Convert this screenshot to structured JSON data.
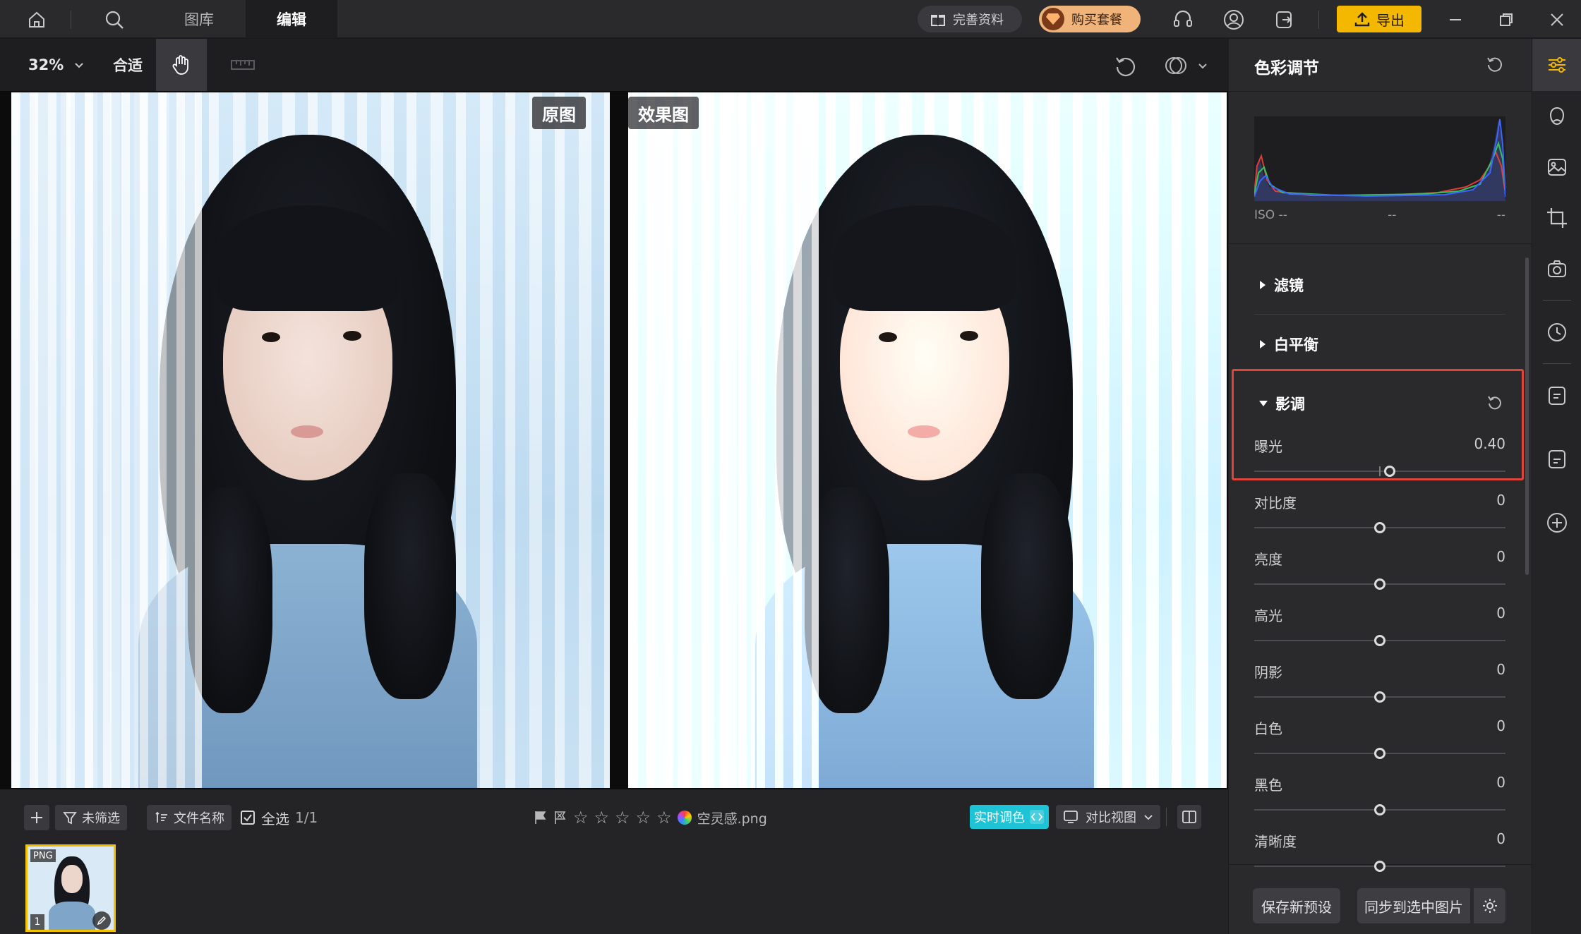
{
  "topbar": {
    "tabs": [
      {
        "label": "图库",
        "active": false
      },
      {
        "label": "编辑",
        "active": true
      }
    ],
    "complete_info_label": "完善资料",
    "buy_plan_label": "购买套餐",
    "export_label": "导出",
    "icons": [
      "home-icon",
      "search-icon",
      "gift-icon",
      "diamond-icon",
      "headset-icon",
      "user-icon",
      "logout-icon",
      "upload-icon",
      "minimize-icon",
      "restore-icon",
      "close-icon"
    ]
  },
  "toolbar": {
    "zoom_value": "32%",
    "fit_label": "合适",
    "icons": [
      "chevron-down-icon",
      "hand-icon",
      "ruler-icon",
      "undo-icon",
      "compare-circles-icon"
    ]
  },
  "preview": {
    "original_label": "原图",
    "result_label": "效果图"
  },
  "bottombar": {
    "add_icon": "plus-icon",
    "filter_label": "未筛选",
    "sort_label": "文件名称",
    "select_all_label": "全选",
    "selection_count": "1/1",
    "filename": "空灵感.png",
    "rating_stars": 5,
    "realtime_label": "实时调色",
    "compare_view_label": "对比视图",
    "thumbnail": {
      "format_badge": "PNG",
      "index": "1"
    },
    "colors": {
      "realtime_bg": "#1fc3d6",
      "thumb_border": "#f2c200"
    }
  },
  "panel": {
    "title": "色彩调节",
    "histogram": {
      "iso_label": "ISO --",
      "mid_label": "--",
      "right_label": "--"
    },
    "sections": [
      {
        "label": "滤镜",
        "expanded": false
      },
      {
        "label": "白平衡",
        "expanded": false
      },
      {
        "label": "影调",
        "expanded": true
      }
    ],
    "sliders": [
      {
        "label": "曝光",
        "value": "0.40",
        "position": 0.54
      },
      {
        "label": "对比度",
        "value": "0",
        "position": 0.5
      },
      {
        "label": "亮度",
        "value": "0",
        "position": 0.5
      },
      {
        "label": "高光",
        "value": "0",
        "position": 0.5
      },
      {
        "label": "阴影",
        "value": "0",
        "position": 0.5
      },
      {
        "label": "白色",
        "value": "0",
        "position": 0.5
      },
      {
        "label": "黑色",
        "value": "0",
        "position": 0.5
      },
      {
        "label": "清晰度",
        "value": "0",
        "position": 0.5
      }
    ],
    "save_preset_label": "保存新预设",
    "sync_label": "同步到选中图片",
    "colors": {
      "highlight_border": "#e0453b"
    }
  },
  "rail": {
    "icons": [
      "color-adjust-icon",
      "portrait-icon",
      "image-edit-icon",
      "crop-icon",
      "camera-icon",
      "history-icon",
      "note-icon",
      "note-alt-icon",
      "add-circle-icon"
    ]
  },
  "colors": {
    "accent": "#f5b800",
    "buy_plan": "#f0b37a"
  }
}
